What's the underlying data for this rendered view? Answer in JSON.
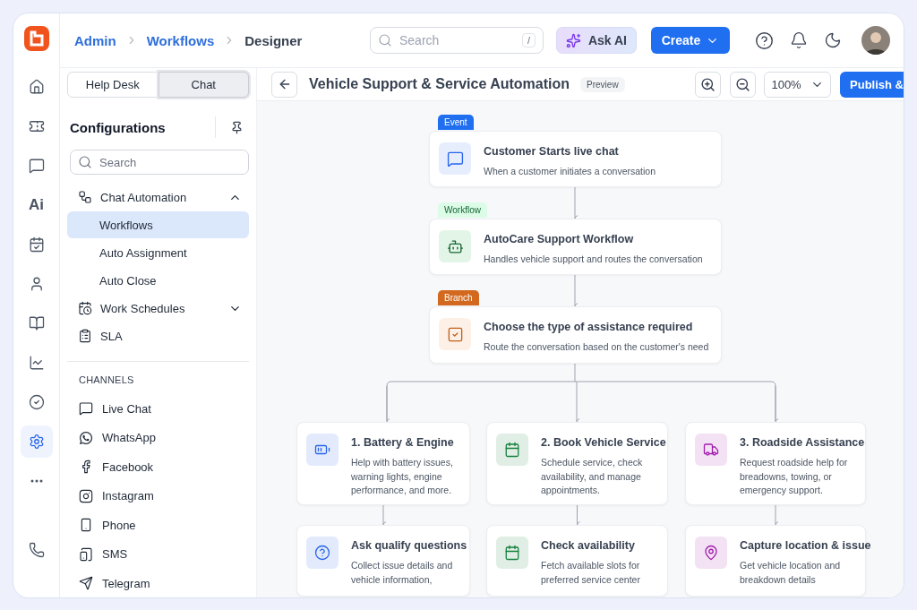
{
  "breadcrumbs": [
    {
      "label": "Admin",
      "current": false
    },
    {
      "label": "Workflows",
      "current": false
    },
    {
      "label": "Designer",
      "current": true
    }
  ],
  "search": {
    "placeholder": "Search",
    "shortcut": "/"
  },
  "ask_ai": "Ask AI",
  "create": "Create",
  "rail": [
    {
      "kind": "icon",
      "selected": false
    },
    {
      "kind": "icon",
      "selected": false
    },
    {
      "kind": "icon",
      "selected": false
    },
    {
      "kind": "text",
      "label": "Ai",
      "selected": false
    },
    {
      "kind": "icon",
      "selected": false
    },
    {
      "kind": "icon",
      "selected": false
    },
    {
      "kind": "icon",
      "selected": false
    },
    {
      "kind": "icon",
      "selected": false
    },
    {
      "kind": "icon",
      "selected": false
    },
    {
      "kind": "icon",
      "selected": true
    },
    {
      "kind": "icon",
      "selected": false
    }
  ],
  "panel": {
    "tabs": [
      {
        "label": "Help Desk",
        "selected": false
      },
      {
        "label": "Chat",
        "selected": true
      }
    ],
    "title": "Configurations",
    "search": {
      "placeholder": "Search"
    },
    "groups": [
      {
        "label": "Chat Automation",
        "expanded": true,
        "children": [
          {
            "label": "Workflows",
            "selected": true
          },
          {
            "label": "Auto Assignment",
            "selected": false
          },
          {
            "label": "Auto Close",
            "selected": false
          }
        ]
      },
      {
        "label": "Work Schedules",
        "expanded": false
      },
      {
        "label": "SLA"
      }
    ],
    "channels_heading": "CHANNELS",
    "channels": [
      "Live Chat",
      "WhatsApp",
      "Facebook",
      "Instagram",
      "Phone",
      "SMS",
      "Telegram"
    ]
  },
  "canvas": {
    "title": "Vehicle Support & Service Automation",
    "badge": "Preview",
    "zoom": "100%",
    "publish": "Publish &",
    "steps": [
      {
        "kind": "event",
        "tag": "Event",
        "title": "Customer Starts live chat",
        "text": "When a customer initiates a conversation"
      },
      {
        "kind": "workflow",
        "tag": "Workflow",
        "title": "AutoCare Support Workflow",
        "text": "Handles vehicle support and routes the conversation"
      },
      {
        "kind": "branch",
        "tag": "Branch",
        "title": "Choose the type of assistance required",
        "text": "Route the conversation based on the customer's need"
      }
    ],
    "branches": [
      {
        "color": "#2563eb",
        "title": "1. Battery & Engine",
        "text": "Help with battery issues, warning lights, engine performance, and more.",
        "next": {
          "title": "Ask qualify questions",
          "text": "Collect issue details and vehicle information,"
        }
      },
      {
        "color": "#15803d",
        "title": "2. Book Vehicle Service",
        "text": "Schedule service, check availability, and manage appointments.",
        "next": {
          "title": "Check availability",
          "text": "Fetch available slots for preferred service center"
        }
      },
      {
        "color": "#a21caf",
        "title": "3. Roadside Assistance",
        "text": "Request roadside help for breadowns, towing, or emergency support.",
        "next": {
          "title": "Capture location & issue",
          "text": "Get vehicle location and breakdown details"
        }
      }
    ]
  }
}
